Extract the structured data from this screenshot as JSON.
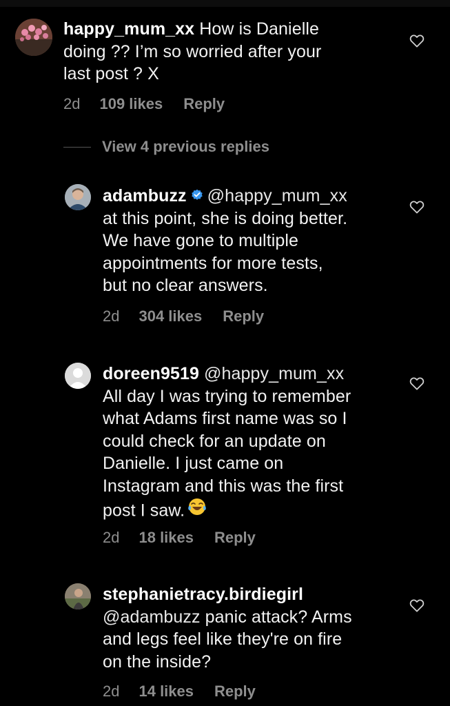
{
  "comments": [
    {
      "username": "happy_mum_xx",
      "line1_rest": "How is Danielle",
      "line2": "doing ?? I’m so worried after your",
      "line3": "last post ? X",
      "time": "2d",
      "likes": "109 likes",
      "reply": "Reply",
      "avatar_icon": "flowers-avatar"
    },
    {
      "username": "adambuzz",
      "mention": "@happy_mum_xx",
      "lines": [
        "at this point, she is doing better.",
        "We have gone to multiple",
        "appointments for more tests,",
        "but no clear answers."
      ],
      "time": "2d",
      "likes": "304 likes",
      "reply": "Reply",
      "avatar_icon": "person-avatar",
      "verified_icon": "verified-badge-icon"
    },
    {
      "username": "doreen9519",
      "mention": "@happy_mum_xx",
      "lines": [
        "All day I was trying to remember",
        "what Adams first name was so I",
        "could check for an update on",
        "Danielle. I just came on",
        "Instagram and this was the first",
        "post I saw."
      ],
      "emoji": "😂",
      "time": "2d",
      "likes": "18 likes",
      "reply": "Reply",
      "avatar_icon": "default-avatar"
    },
    {
      "username": "stephanietracy.birdiegirl",
      "mention": "@adambuzz",
      "lines": [
        "panic attack? Arms",
        "and legs feel like they're on fire",
        "on the inside?"
      ],
      "time": "2d",
      "likes": "14 likes",
      "reply": "Reply",
      "avatar_icon": "photo-avatar"
    }
  ],
  "view_replies": "View 4 previous replies",
  "colors": {
    "background": "#000000",
    "text": "#f2f2f2",
    "meta": "#8e8e8e",
    "verified": "#3897f0"
  }
}
